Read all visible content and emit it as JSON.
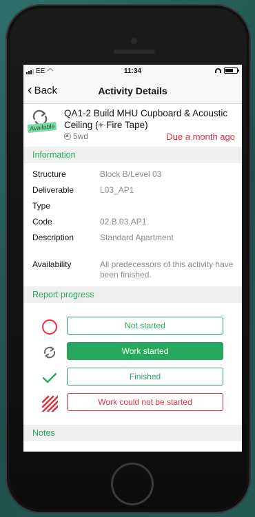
{
  "status_bar": {
    "carrier": "EE",
    "time": "11:34"
  },
  "nav": {
    "back_label": "Back",
    "title": "Activity Details"
  },
  "activity": {
    "title": "QA1-2 Build MHU Cupboard & Acoustic Ceiling (+ Fire Tape)",
    "badge": "Available",
    "duration": "5wd",
    "due": "Due a month ago"
  },
  "information": {
    "header": "Information",
    "rows": [
      {
        "label": "Structure",
        "value": "Block B/Level 03"
      },
      {
        "label": "Deliverable",
        "value": "L03_AP1"
      },
      {
        "label": "Type",
        "value": ""
      },
      {
        "label": "Code",
        "value": "02.B.03.AP1"
      },
      {
        "label": "Description",
        "value": "Standard Apartment"
      },
      {
        "label": "Availability",
        "value": "All predecessors of this activity have been finished."
      }
    ]
  },
  "report_progress": {
    "header": "Report progress",
    "options": [
      {
        "label": "Not started",
        "icon": "circle-icon",
        "selected": false
      },
      {
        "label": "Work started",
        "icon": "refresh-icon",
        "selected": true
      },
      {
        "label": "Finished",
        "icon": "checkmark-icon",
        "selected": false
      },
      {
        "label": "Work could not be started",
        "icon": "hatched-icon",
        "selected": false
      }
    ]
  },
  "notes": {
    "header": "Notes"
  },
  "colors": {
    "accent_green": "#27a85e",
    "alert_red": "#e0323c",
    "badge_green": "#7fd9a5"
  }
}
